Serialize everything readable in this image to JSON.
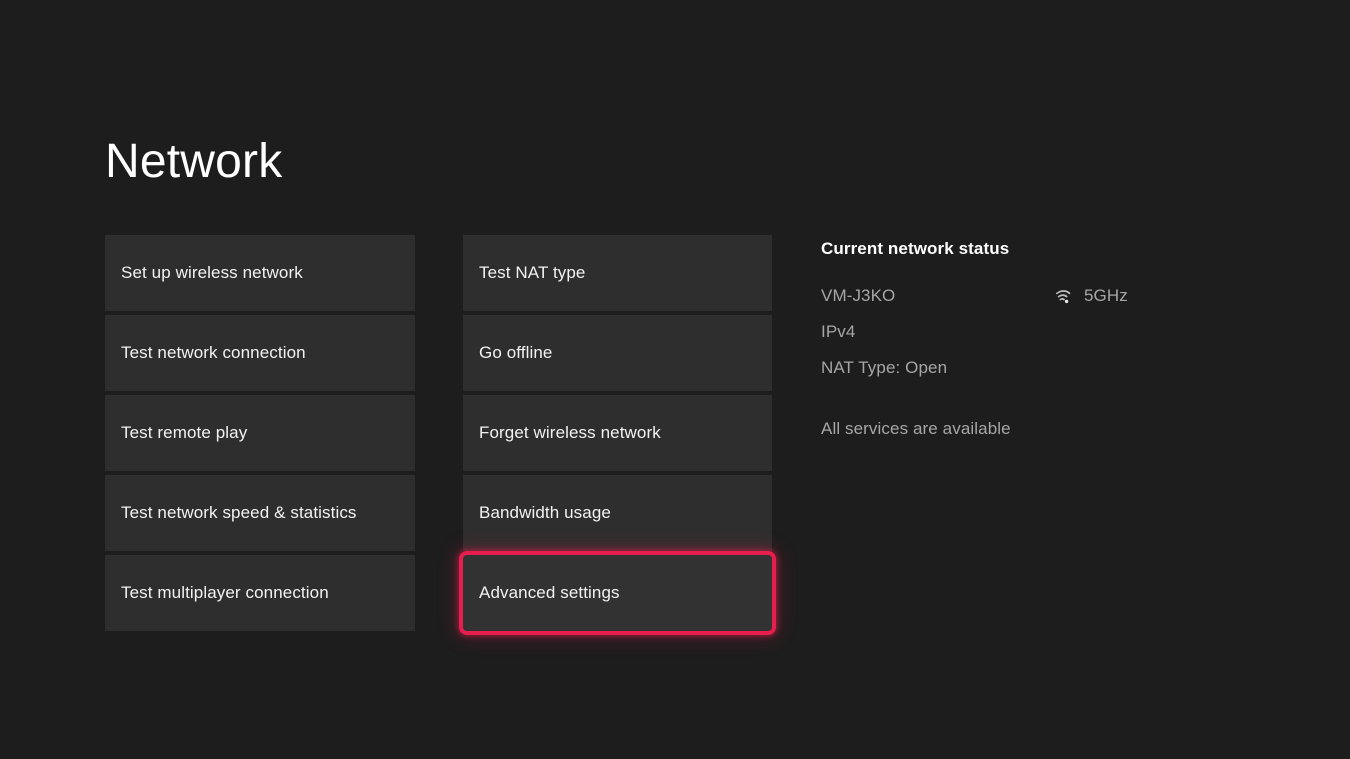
{
  "page": {
    "title": "Network",
    "background_color": "#1d1d1d",
    "tile_color": "#2e2e2e",
    "highlight_color": "#e61e4d"
  },
  "columns": {
    "left": [
      {
        "label": "Set up wireless network"
      },
      {
        "label": "Test network connection"
      },
      {
        "label": "Test remote play"
      },
      {
        "label": "Test network speed & statistics"
      },
      {
        "label": "Test multiplayer connection"
      }
    ],
    "middle": [
      {
        "label": "Test NAT type"
      },
      {
        "label": "Go offline"
      },
      {
        "label": "Forget wireless network"
      },
      {
        "label": "Bandwidth usage"
      },
      {
        "label": "Advanced settings"
      }
    ]
  },
  "status": {
    "heading": "Current network status",
    "network_name": "VM-J3KO",
    "signal_band": "5GHz",
    "signal_icon": "wifi-icon",
    "ip_version": "IPv4",
    "nat_type": "NAT Type: Open",
    "services": "All services are available"
  }
}
